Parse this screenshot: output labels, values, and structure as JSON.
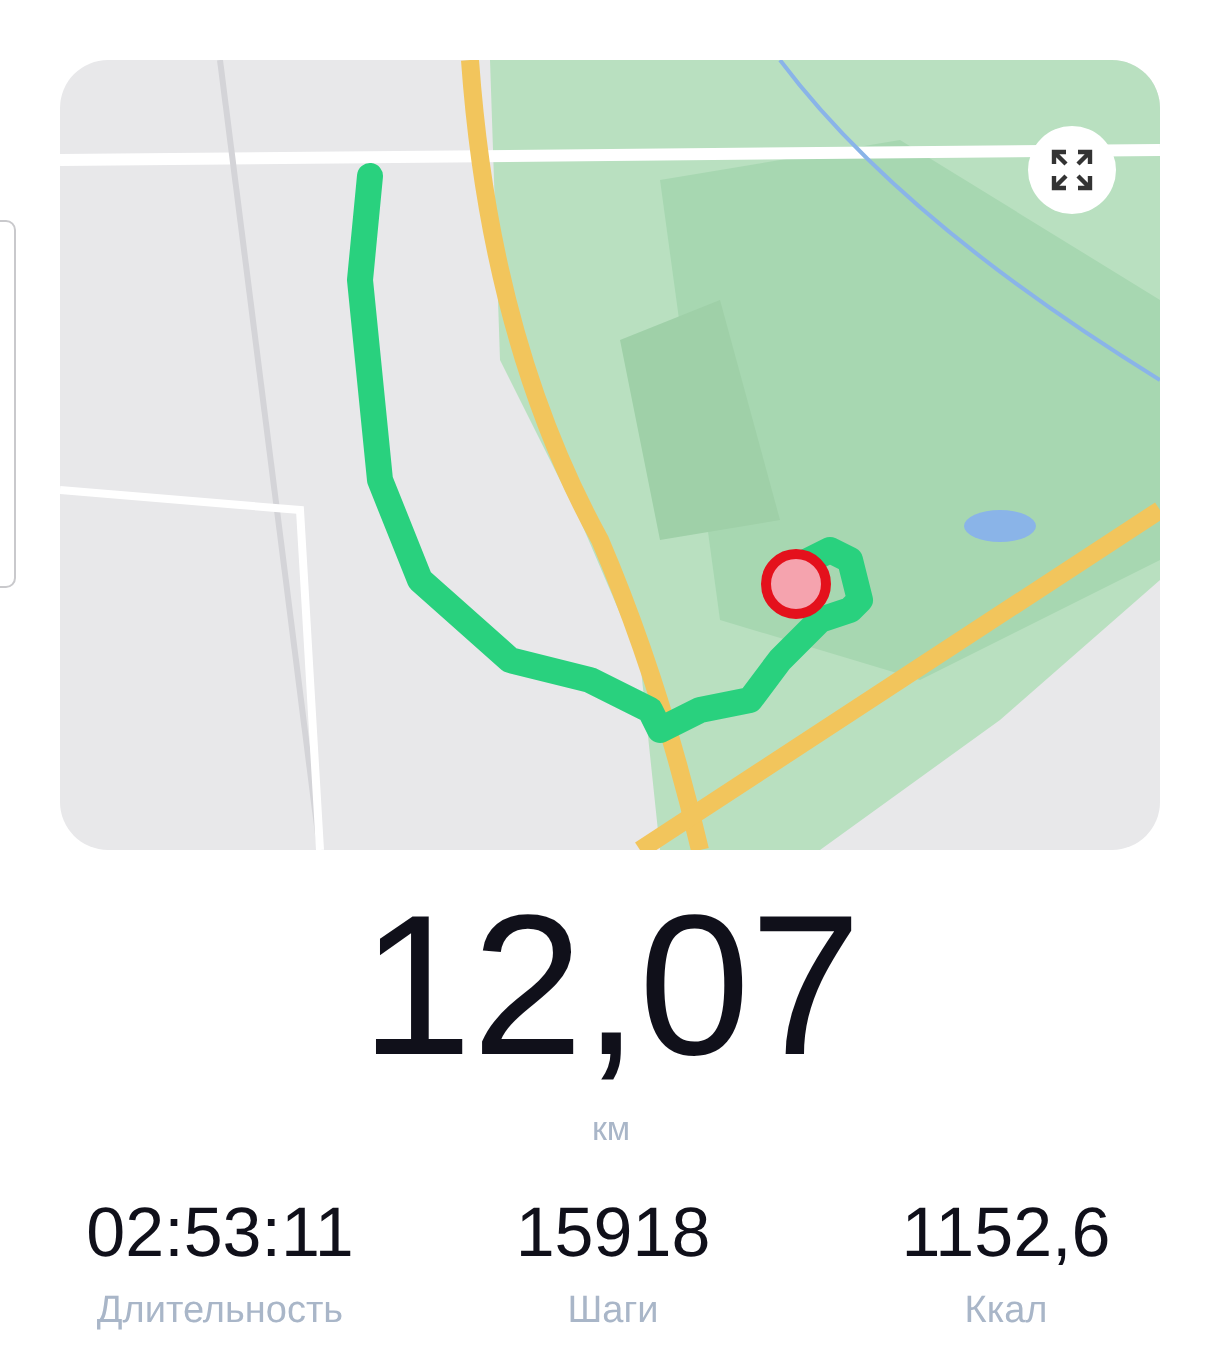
{
  "distance": {
    "value": "12,07",
    "unit": "км"
  },
  "stats": [
    {
      "value": "02:53:11",
      "label": "Длительность"
    },
    {
      "value": "15918",
      "label": "Шаги"
    },
    {
      "value": "1152,6",
      "label": "Ккал"
    }
  ]
}
